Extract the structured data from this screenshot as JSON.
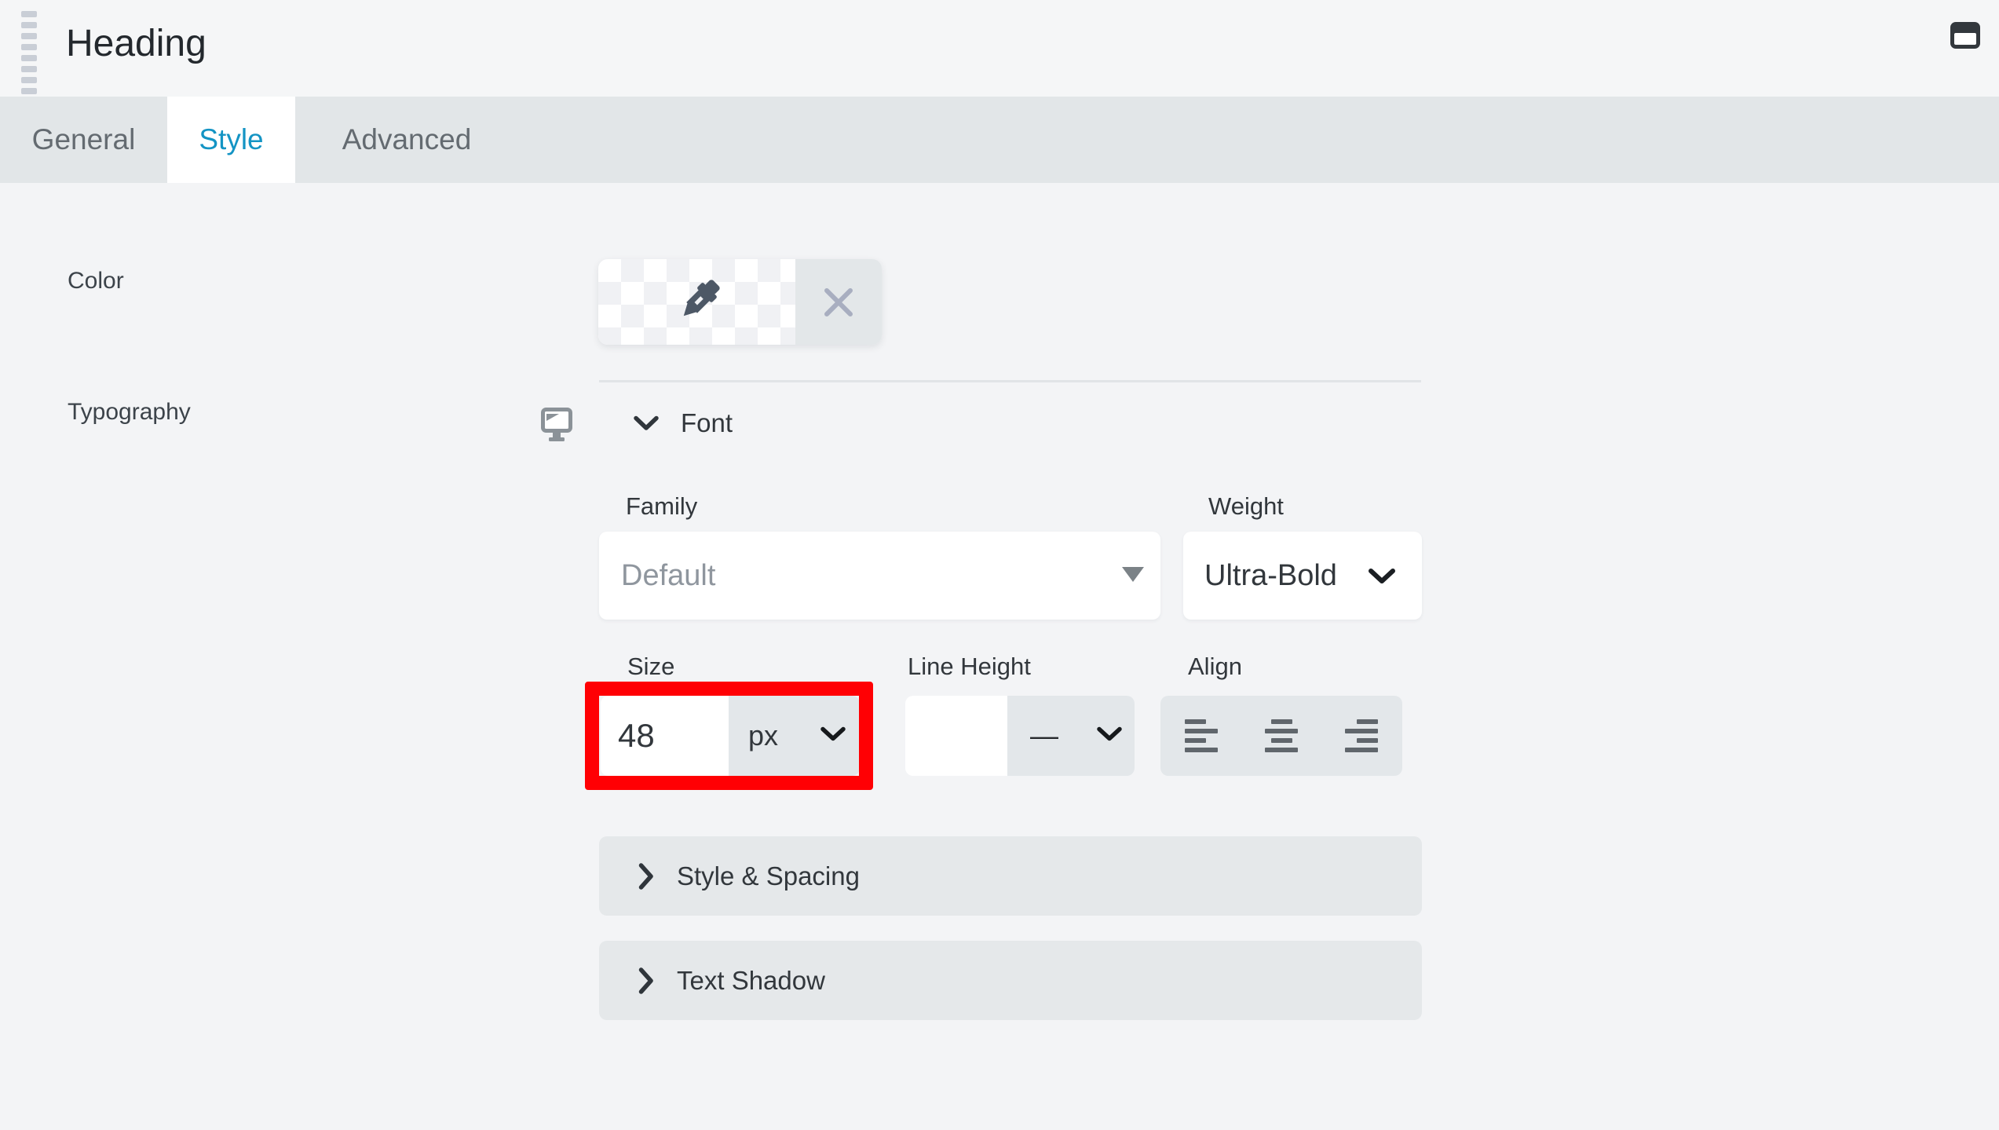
{
  "header": {
    "title": "Heading"
  },
  "tabs": [
    {
      "label": "General"
    },
    {
      "label": "Style"
    },
    {
      "label": "Advanced"
    }
  ],
  "active_tab": "Style",
  "panel": {
    "color": {
      "label": "Color"
    },
    "typography": {
      "label": "Typography",
      "font_section": {
        "title": "Font",
        "family": {
          "label": "Family",
          "value": "Default"
        },
        "weight": {
          "label": "Weight",
          "value": "Ultra-Bold"
        },
        "size": {
          "label": "Size",
          "value": "48",
          "unit": "px"
        },
        "line_height": {
          "label": "Line Height",
          "value": "",
          "unit": "—"
        },
        "align": {
          "label": "Align"
        }
      }
    },
    "collapsed_sections": [
      {
        "title": "Style & Spacing"
      },
      {
        "title": "Text Shadow"
      }
    ]
  },
  "icons": {
    "drag_handle": "grip-dashes",
    "header_right": "window-icon",
    "color_swatch": "eyedropper-icon",
    "clear_color": "x-icon",
    "responsive_toggle": "monitor-icon",
    "expanded": "chevron-down-icon",
    "collapsed": "chevron-right-icon",
    "align_options": [
      "align-left-icon",
      "align-center-icon",
      "align-right-icon"
    ]
  },
  "colors": {
    "active_tab_text": "#1494c4",
    "highlight_border": "#ff0004",
    "panel_background": "#f3f4f6",
    "tabbar_background": "#e2e6e8"
  }
}
